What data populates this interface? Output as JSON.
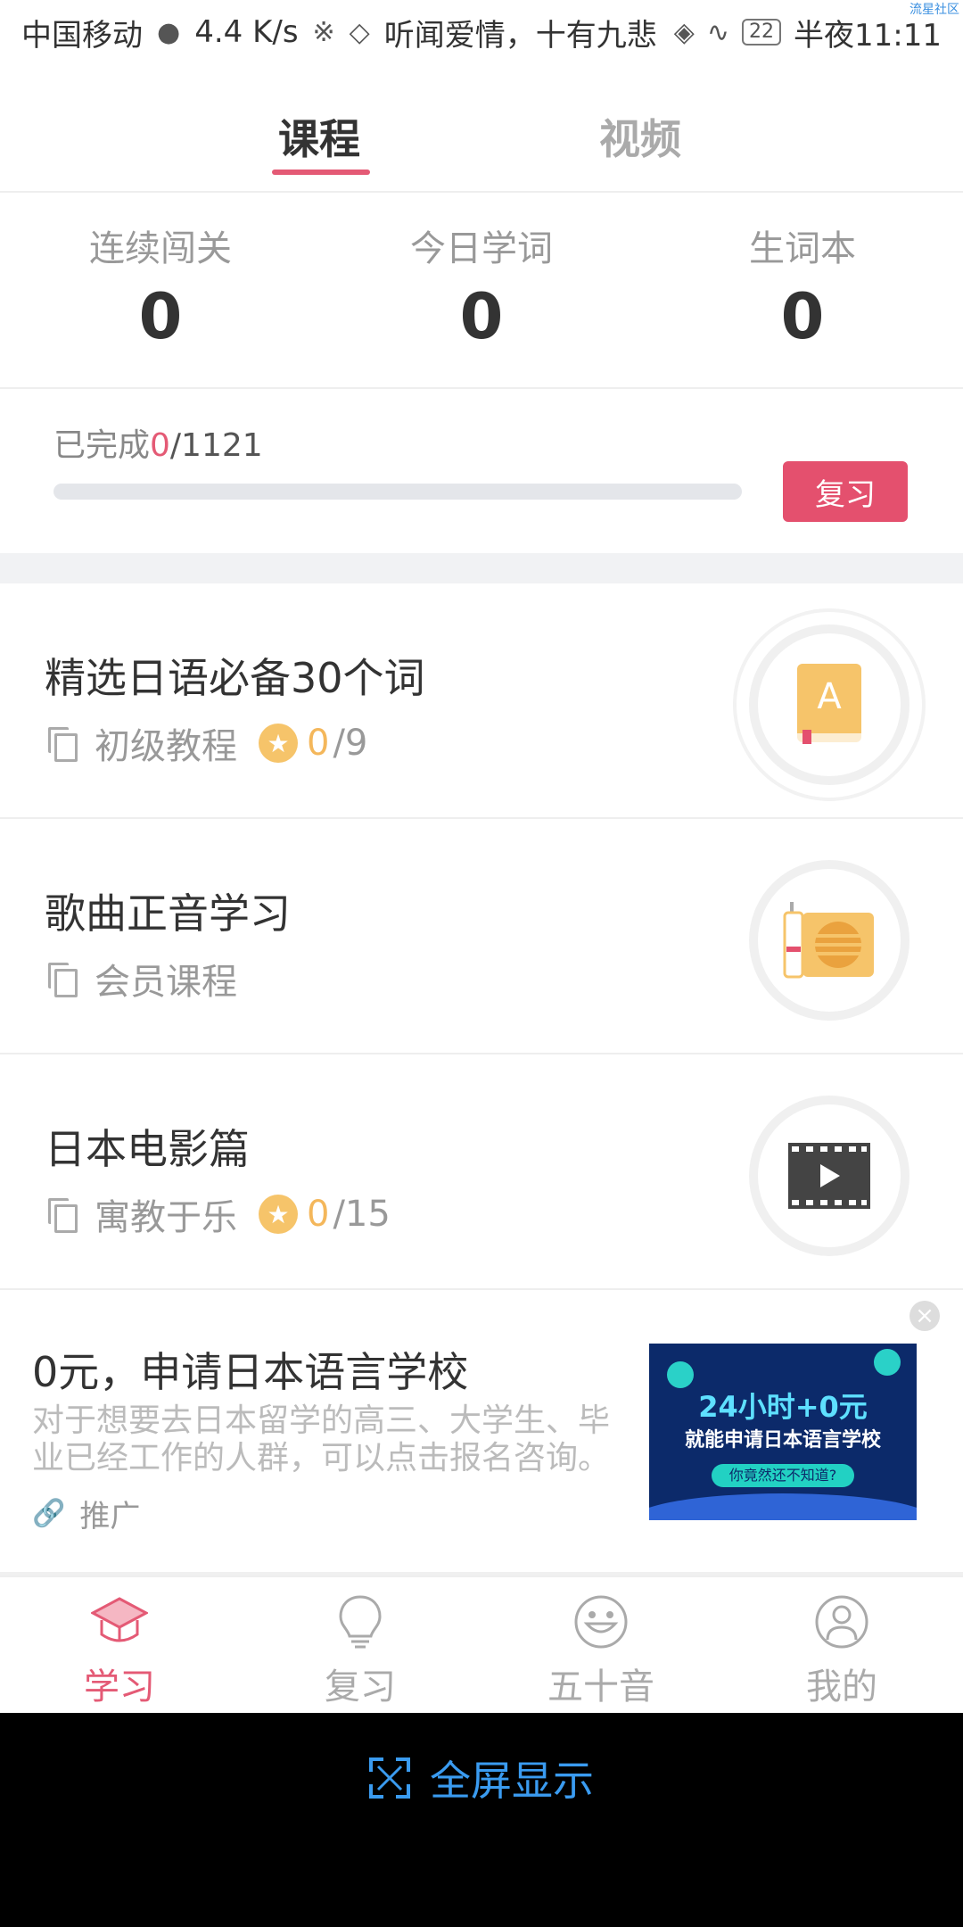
{
  "status_bar": {
    "carrier": "中国移动",
    "speed": "4.4 K/s",
    "song": "听闻爱情，十有九悲",
    "battery": "22",
    "time": "半夜11:11",
    "watermark": "流星社区"
  },
  "top_tabs": [
    {
      "label": "课程",
      "active": true
    },
    {
      "label": "视频",
      "active": false
    }
  ],
  "stats": [
    {
      "label": "连续闯关",
      "value": "0"
    },
    {
      "label": "今日学词",
      "value": "0"
    },
    {
      "label": "生词本",
      "value": "0"
    }
  ],
  "progress": {
    "prefix": "已完成",
    "done": "0",
    "total": "/1121",
    "fraction": 0,
    "button": "复习"
  },
  "courses": [
    {
      "title": "精选日语必备30个词",
      "tag": "初级教程",
      "done": "0",
      "total": "/9",
      "icon": "book-a-icon"
    },
    {
      "title": "歌曲正音学习",
      "tag": "会员课程",
      "icon": "radio-icon"
    },
    {
      "title": "日本电影篇",
      "tag": "寓教于乐",
      "done": "0",
      "total": "/15",
      "icon": "film-icon"
    }
  ],
  "ad": {
    "title": "0元，申请日本语言学校",
    "description": "对于想要去日本留学的高三、大学生、毕业已经工作的人群，可以点击报名咨询。",
    "promo": "推广",
    "banner_line1": "24小时+0元",
    "banner_line2": "就能申请日本语言学校",
    "banner_pill": "你竟然还不知道?"
  },
  "bottom_nav": [
    {
      "label": "学习",
      "active": true,
      "icon": "graduation-cap-icon"
    },
    {
      "label": "复习",
      "active": false,
      "icon": "lightbulb-icon"
    },
    {
      "label": "五十音",
      "active": false,
      "icon": "smiley-icon"
    },
    {
      "label": "我的",
      "active": false,
      "icon": "user-icon"
    }
  ],
  "fullscreen": {
    "label": "全屏显示"
  },
  "colors": {
    "accent": "#e45a75",
    "star": "#f6c46a",
    "fullscreen": "#3a9bf0"
  }
}
